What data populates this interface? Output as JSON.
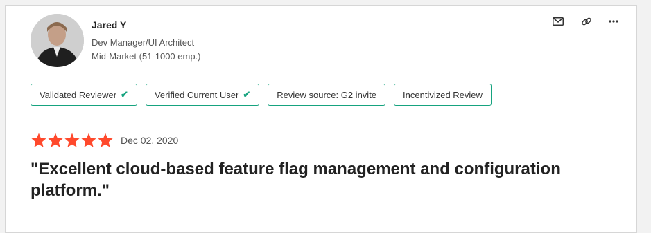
{
  "reviewer": {
    "name": "Jared Y",
    "role": "Dev Manager/UI Architect",
    "segment": "Mid-Market (51-1000 emp.)"
  },
  "actions": {
    "icons": [
      "mail-icon",
      "link-icon",
      "more-icon"
    ]
  },
  "badges": [
    {
      "label": "Validated Reviewer",
      "checked": true
    },
    {
      "label": "Verified Current User",
      "checked": true
    },
    {
      "label": "Review source: G2 invite",
      "checked": false
    },
    {
      "label": "Incentivized Review",
      "checked": false
    }
  ],
  "review": {
    "rating": 5,
    "max_rating": 5,
    "date": "Dec 02, 2020",
    "title": "\"Excellent cloud-based feature flag management and configuration platform.\""
  },
  "colors": {
    "accent": "#16a37f",
    "star": "#ff492c"
  }
}
